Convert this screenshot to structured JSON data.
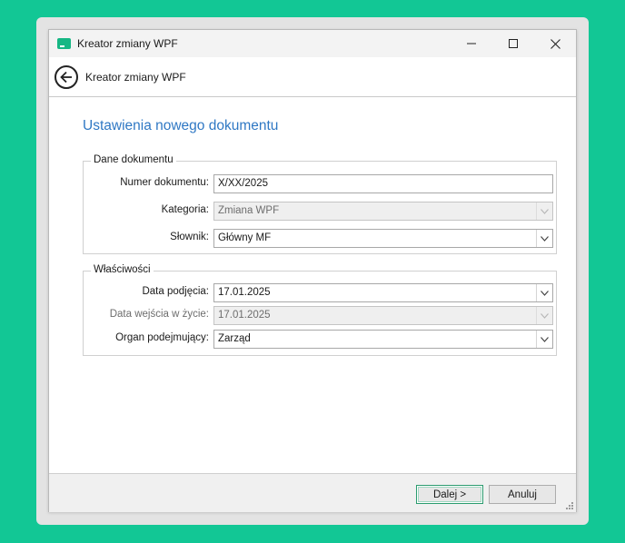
{
  "window": {
    "title": "Kreator zmiany WPF",
    "controls": {
      "minimize_icon": "minimize-icon",
      "maximize_icon": "maximize-icon",
      "close_icon": "close-icon"
    }
  },
  "subheader": {
    "title": "Kreator zmiany WPF",
    "back_icon": "arrow-left-circle-icon"
  },
  "page": {
    "heading": "Ustawienia nowego dokumentu"
  },
  "dane_dokumentu": {
    "legend": "Dane dokumentu",
    "numer_label": "Numer dokumentu:",
    "numer_value": "X/XX/2025",
    "kategoria_label": "Kategoria:",
    "kategoria_value": "Zmiana WPF",
    "slownik_label": "Słownik:",
    "slownik_value": "Główny MF"
  },
  "wlasciwosci": {
    "legend": "Właściwości",
    "data_podjecia_label": "Data podjęcia:",
    "data_podjecia_value": "17.01.2025",
    "data_wejscia_label": "Data wejścia w życie:",
    "data_wejscia_value": "17.01.2025",
    "organ_label": "Organ podejmujący:",
    "organ_value": "Zarząd"
  },
  "footer": {
    "next_label": "Dalej >",
    "cancel_label": "Anuluj"
  },
  "colors": {
    "background": "#12c795",
    "heading": "#2f78c4",
    "app_icon": "#16b784"
  }
}
